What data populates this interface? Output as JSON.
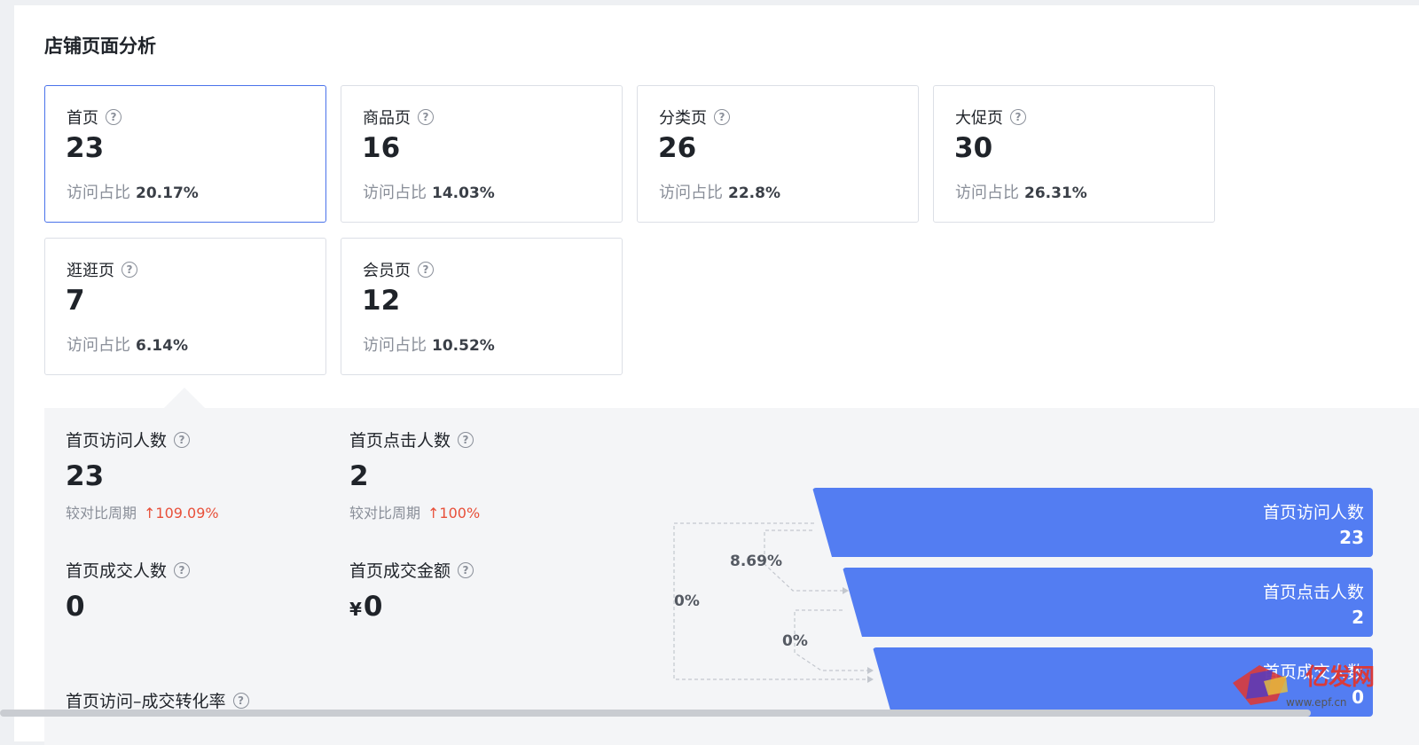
{
  "page": {
    "title": "店铺页面分析"
  },
  "cards": [
    {
      "label": "首页",
      "value": "23",
      "ratio_label": "访问占比",
      "ratio": "20.17%",
      "active": true
    },
    {
      "label": "商品页",
      "value": "16",
      "ratio_label": "访问占比",
      "ratio": "14.03%"
    },
    {
      "label": "分类页",
      "value": "26",
      "ratio_label": "访问占比",
      "ratio": "22.8%"
    },
    {
      "label": "大促页",
      "value": "30",
      "ratio_label": "访问占比",
      "ratio": "26.31%"
    },
    {
      "label": "逛逛页",
      "value": "7",
      "ratio_label": "访问占比",
      "ratio": "6.14%"
    },
    {
      "label": "会员页",
      "value": "12",
      "ratio_label": "访问占比",
      "ratio": "10.52%"
    }
  ],
  "metrics": {
    "visitors": {
      "label": "首页访问人数",
      "value": "23",
      "compare_label": "较对比周期",
      "change": "↑109.09%"
    },
    "clicks": {
      "label": "首页点击人数",
      "value": "2",
      "compare_label": "较对比周期",
      "change": "↑100%"
    },
    "buyers": {
      "label": "首页成交人数",
      "value": "0"
    },
    "amount": {
      "label": "首页成交金额",
      "currency": "¥",
      "value": "0"
    },
    "conversion": {
      "label": "首页访问–成交转化率"
    }
  },
  "funnel": {
    "bars": [
      {
        "label": "首页访问人数",
        "value": "23"
      },
      {
        "label": "首页点击人数",
        "value": "2"
      },
      {
        "label": "首页成交人数",
        "value": "0"
      }
    ],
    "rates": {
      "visit_to_click": "8.69%",
      "visit_to_deal": "0%",
      "click_to_deal": "0%"
    }
  },
  "colors": {
    "accent": "#537df2",
    "up": "#e8503a",
    "active_border": "#4a72ea"
  },
  "watermark": {
    "text": "亿发网",
    "url": "www.epf.cn"
  }
}
